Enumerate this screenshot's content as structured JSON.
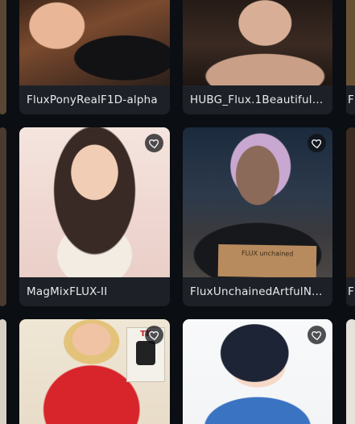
{
  "gallery": {
    "cards": [
      {
        "title": "FluxPonyRealF1D-alpha",
        "favorite_icon": "heart-outline-icon",
        "shows_favorite": false
      },
      {
        "title": "HUBG_Flux.1BeautifulR...",
        "favorite_icon": "heart-outline-icon",
        "shows_favorite": false
      },
      {
        "title": "MagMixFLUX-II",
        "favorite_icon": "heart-outline-icon",
        "shows_favorite": true
      },
      {
        "title": "FluxUnchainedArtfulN...",
        "favorite_icon": "heart-outline-icon",
        "shows_favorite": true
      },
      {
        "title": "",
        "favorite_icon": "heart-outline-icon",
        "shows_favorite": true
      },
      {
        "title": "",
        "favorite_icon": "heart-outline-icon",
        "shows_favorite": true
      }
    ],
    "partial_right_captions": [
      "F",
      "F"
    ],
    "image_text": {
      "sign": "FLUX unchained",
      "poster": "TE"
    }
  },
  "colors": {
    "background": "#0b0e12",
    "card_caption_bg": "#1d2127",
    "caption_text": "#e8eaed"
  }
}
